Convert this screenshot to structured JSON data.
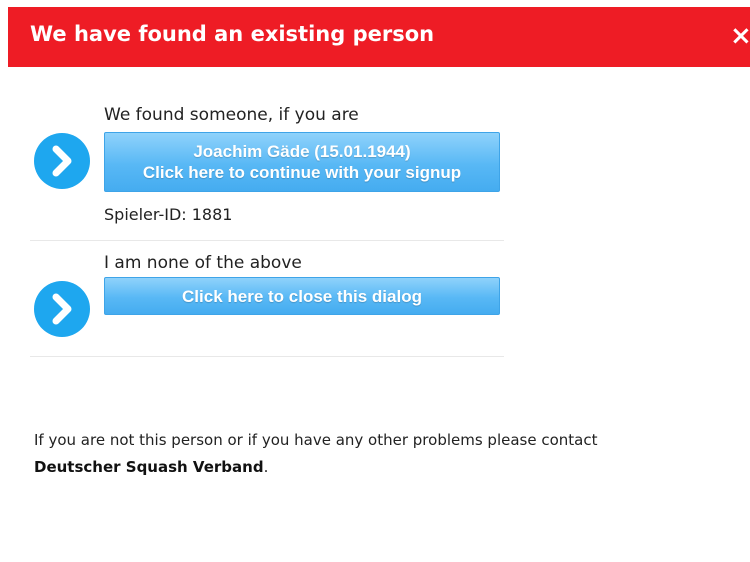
{
  "dialog": {
    "title": "We have found an existing person",
    "close_symbol": "×",
    "header_color": "#ee1c25",
    "accent_color": "#1ea7ef"
  },
  "options": [
    {
      "label": "We found someone, if you are",
      "button_lines": [
        "Joachim Gäde (15.01.1944)",
        "Click here to continue with your signup"
      ],
      "player_id": "Spieler-ID: 1881",
      "icon": "chevron-right-circle-icon"
    },
    {
      "label": "I am none of the above",
      "button_lines": [
        "Click here to close this dialog"
      ],
      "icon": "chevron-right-circle-icon"
    }
  ],
  "footer": {
    "text": "If you are not this person or if you have any other problems please contact",
    "org_name": "Deutscher Squash Verband",
    "suffix": "."
  }
}
